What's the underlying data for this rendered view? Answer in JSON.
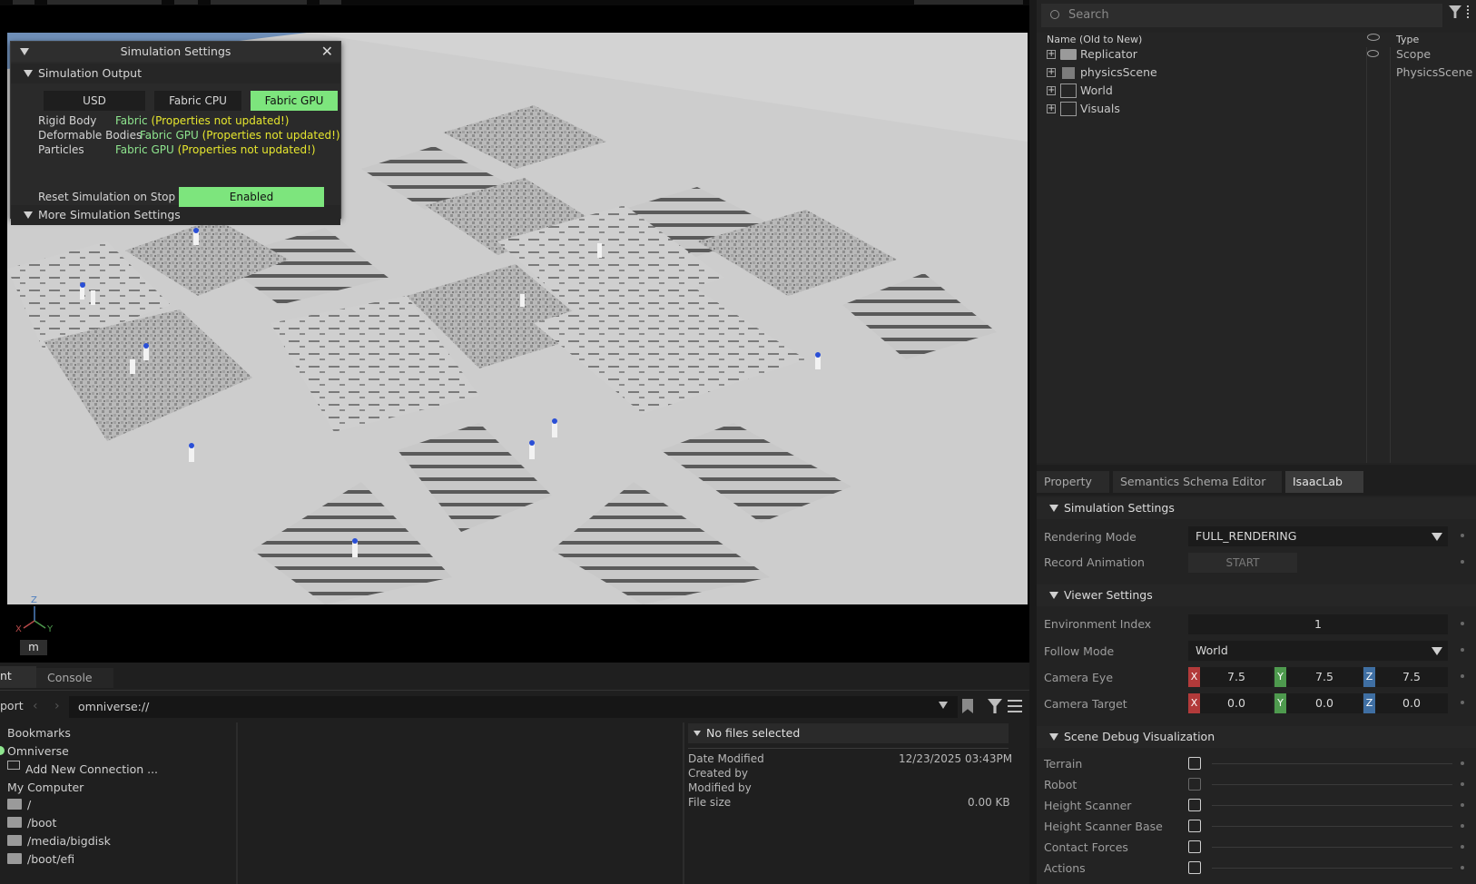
{
  "sim_window": {
    "title": "Simulation Settings",
    "output_section": "Simulation Output",
    "buttons": [
      "USD",
      "Fabric CPU",
      "Fabric GPU"
    ],
    "active_button": "Fabric GPU",
    "rows": [
      {
        "label": "Rigid Body",
        "value": "Fabric",
        "note": "(Properties not updated!)"
      },
      {
        "label": "Deformable Bodies",
        "value": "Fabric GPU",
        "note": "(Properties not updated!)"
      },
      {
        "label": "Particles",
        "value": "Fabric GPU",
        "note": "(Properties not updated!)"
      }
    ],
    "more_section": "More Simulation Settings",
    "reset_label": "Reset Simulation on Stop",
    "reset_value": "Enabled"
  },
  "viewport": {
    "units_button": "m",
    "axis_labels": {
      "x": "X",
      "y": "Y",
      "z": "Z"
    }
  },
  "stage": {
    "search_placeholder": "Search",
    "col_name": "Name (Old to New)",
    "col_type": "Type",
    "items": [
      {
        "name": "Replicator",
        "type": "Scope"
      },
      {
        "name": "physicsScene",
        "type": "PhysicsScene"
      },
      {
        "name": "World",
        "type": ""
      },
      {
        "name": "Visuals",
        "type": ""
      }
    ]
  },
  "tabs": [
    "Property",
    "Semantics Schema Editor",
    "IsaacLab"
  ],
  "active_tab": "IsaacLab",
  "isaaclab": {
    "sim_section": "Simulation Settings",
    "rendering_mode_label": "Rendering Mode",
    "rendering_mode_value": "FULL_RENDERING",
    "record_label": "Record Animation",
    "record_button": "START",
    "viewer_section": "Viewer Settings",
    "env_index_label": "Environment Index",
    "env_index_value": "1",
    "follow_label": "Follow Mode",
    "follow_value": "World",
    "cam_eye_label": "Camera Eye",
    "cam_eye": [
      "7.5",
      "7.5",
      "7.5"
    ],
    "cam_target_label": "Camera Target",
    "cam_target": [
      "0.0",
      "0.0",
      "0.0"
    ],
    "axis_x": "X",
    "axis_y": "Y",
    "axis_z": "Z",
    "debug_section": "Scene Debug Visualization",
    "debug_items": [
      "Terrain",
      "Robot",
      "Height Scanner",
      "Height Scanner Base",
      "Contact Forces",
      "Actions"
    ]
  },
  "bottom": {
    "tab_partial": "nt",
    "tab_console": "Console",
    "import_partial": "port",
    "path": "omniverse://",
    "nav": {
      "bookmarks": "Bookmarks",
      "omniverse": "Omniverse",
      "add_connection": "Add New Connection ...",
      "my_computer": "My Computer",
      "folders": [
        "/",
        "/boot",
        "/media/bigdisk",
        "/boot/efi"
      ]
    },
    "info": {
      "header": "No files selected",
      "date_modified_label": "Date Modified",
      "date_modified_value": "12/23/2025 03:43PM",
      "created_by_label": "Created by",
      "modified_by_label": "Modified by",
      "file_size_label": "File size",
      "file_size_value": "0.00 KB"
    }
  },
  "colors": {
    "accent_green": "#7de57d",
    "warning_yellow": "#e6e62e",
    "axis_x": "#b23a3a",
    "axis_y": "#4e9a4e",
    "axis_z": "#3f6fa3"
  }
}
